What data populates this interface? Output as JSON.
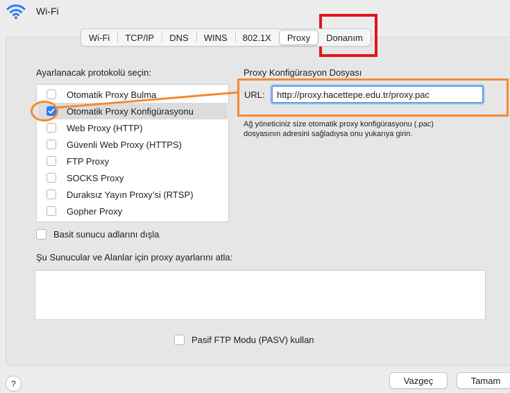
{
  "header": {
    "title": "Wi-Fi",
    "icon": "wifi-icon"
  },
  "tabs": [
    {
      "label": "Wi-Fi",
      "active": false
    },
    {
      "label": "TCP/IP",
      "active": false
    },
    {
      "label": "DNS",
      "active": false
    },
    {
      "label": "WINS",
      "active": false
    },
    {
      "label": "802.1X",
      "active": false
    },
    {
      "label": "Proxy",
      "active": true
    },
    {
      "label": "Donanım",
      "active": false
    }
  ],
  "protocols": {
    "heading": "Ayarlanacak protokolü seçin:",
    "items": [
      {
        "label": "Otomatik Proxy Bulma",
        "checked": false,
        "selected": false
      },
      {
        "label": "Otomatik Proxy Konfigürasyonu",
        "checked": true,
        "selected": true
      },
      {
        "label": "Web Proxy (HTTP)",
        "checked": false,
        "selected": false
      },
      {
        "label": "Güvenli Web Proxy (HTTPS)",
        "checked": false,
        "selected": false
      },
      {
        "label": "FTP Proxy",
        "checked": false,
        "selected": false
      },
      {
        "label": "SOCKS Proxy",
        "checked": false,
        "selected": false
      },
      {
        "label": "Duraksız Yayın Proxy’si (RTSP)",
        "checked": false,
        "selected": false
      },
      {
        "label": "Gopher Proxy",
        "checked": false,
        "selected": false
      }
    ]
  },
  "pac": {
    "heading": "Proxy Konfigürasyon Dosyası",
    "url_label": "URL:",
    "url_value": "http://proxy.hacettepe.edu.tr/proxy.pac",
    "help_text": "Ağ yöneticiniz size otomatik proxy konfigürasyonu (.pac) dosyasının adresini sağladıysa onu yukarıya girin."
  },
  "exclude_simple": {
    "label": "Basit sunucu adlarını dışla",
    "checked": false
  },
  "bypass": {
    "label": "Şu Sunucular ve Alanlar için proxy ayarlarını atla:",
    "value": ""
  },
  "pasv": {
    "label": "Pasif FTP Modu (PASV) kullan",
    "checked": false
  },
  "footer": {
    "help_label": "?",
    "cancel_label": "Vazgeç",
    "ok_label": "Tamam"
  },
  "colors": {
    "accent": "#2d7cf6",
    "annotation_red": "#e0161c",
    "annotation_orange": "#f7882f"
  }
}
